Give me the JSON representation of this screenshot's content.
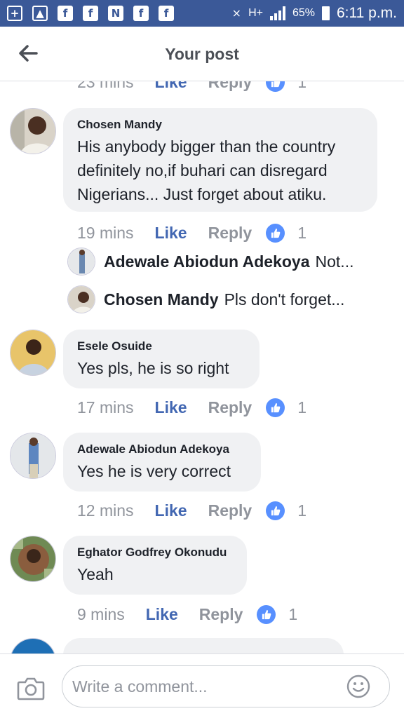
{
  "status_bar": {
    "icons": [
      "add-box-icon",
      "image-icon",
      "facebook-icon",
      "facebook-icon",
      "n-icon",
      "facebook-icon",
      "facebook-icon"
    ],
    "network": "H+",
    "battery": "65%",
    "time": "6:11 p.m."
  },
  "header": {
    "title": "Your post"
  },
  "partial_top": {
    "time": "23 mins",
    "like": "Like",
    "reply": "Reply",
    "count": "1"
  },
  "comments": [
    {
      "name": "Chosen Mandy",
      "text": "His anybody bigger than the country definitely no,if buhari can disregard Nigerians... Just forget about atiku.",
      "time": "19 mins",
      "like": "Like",
      "reply": "Reply",
      "count": "1"
    },
    {
      "name": "Esele Osuide",
      "text": "Yes pls, he is so right",
      "time": "17 mins",
      "like": "Like",
      "reply": "Reply",
      "count": "1"
    },
    {
      "name": "Adewale Abiodun Adekoya",
      "text": "Yes he is very correct",
      "time": "12 mins",
      "like": "Like",
      "reply": "Reply",
      "count": "1"
    },
    {
      "name": "Eghator Godfrey Okonudu",
      "text": "Yeah",
      "time": "9 mins",
      "like": "Like",
      "reply": "Reply",
      "count": "1"
    }
  ],
  "replies": [
    {
      "name": "Adewale Abiodun Adekoya",
      "text": "Not..."
    },
    {
      "name": "Chosen Mandy",
      "text": "Pls don't forget..."
    }
  ],
  "composer": {
    "placeholder": "Write a comment..."
  },
  "colors": {
    "brand": "#3b5998",
    "like_blue": "#4267b2",
    "badge_blue": "#5890ff",
    "bubble": "#f0f1f3",
    "muted": "#90949c"
  }
}
